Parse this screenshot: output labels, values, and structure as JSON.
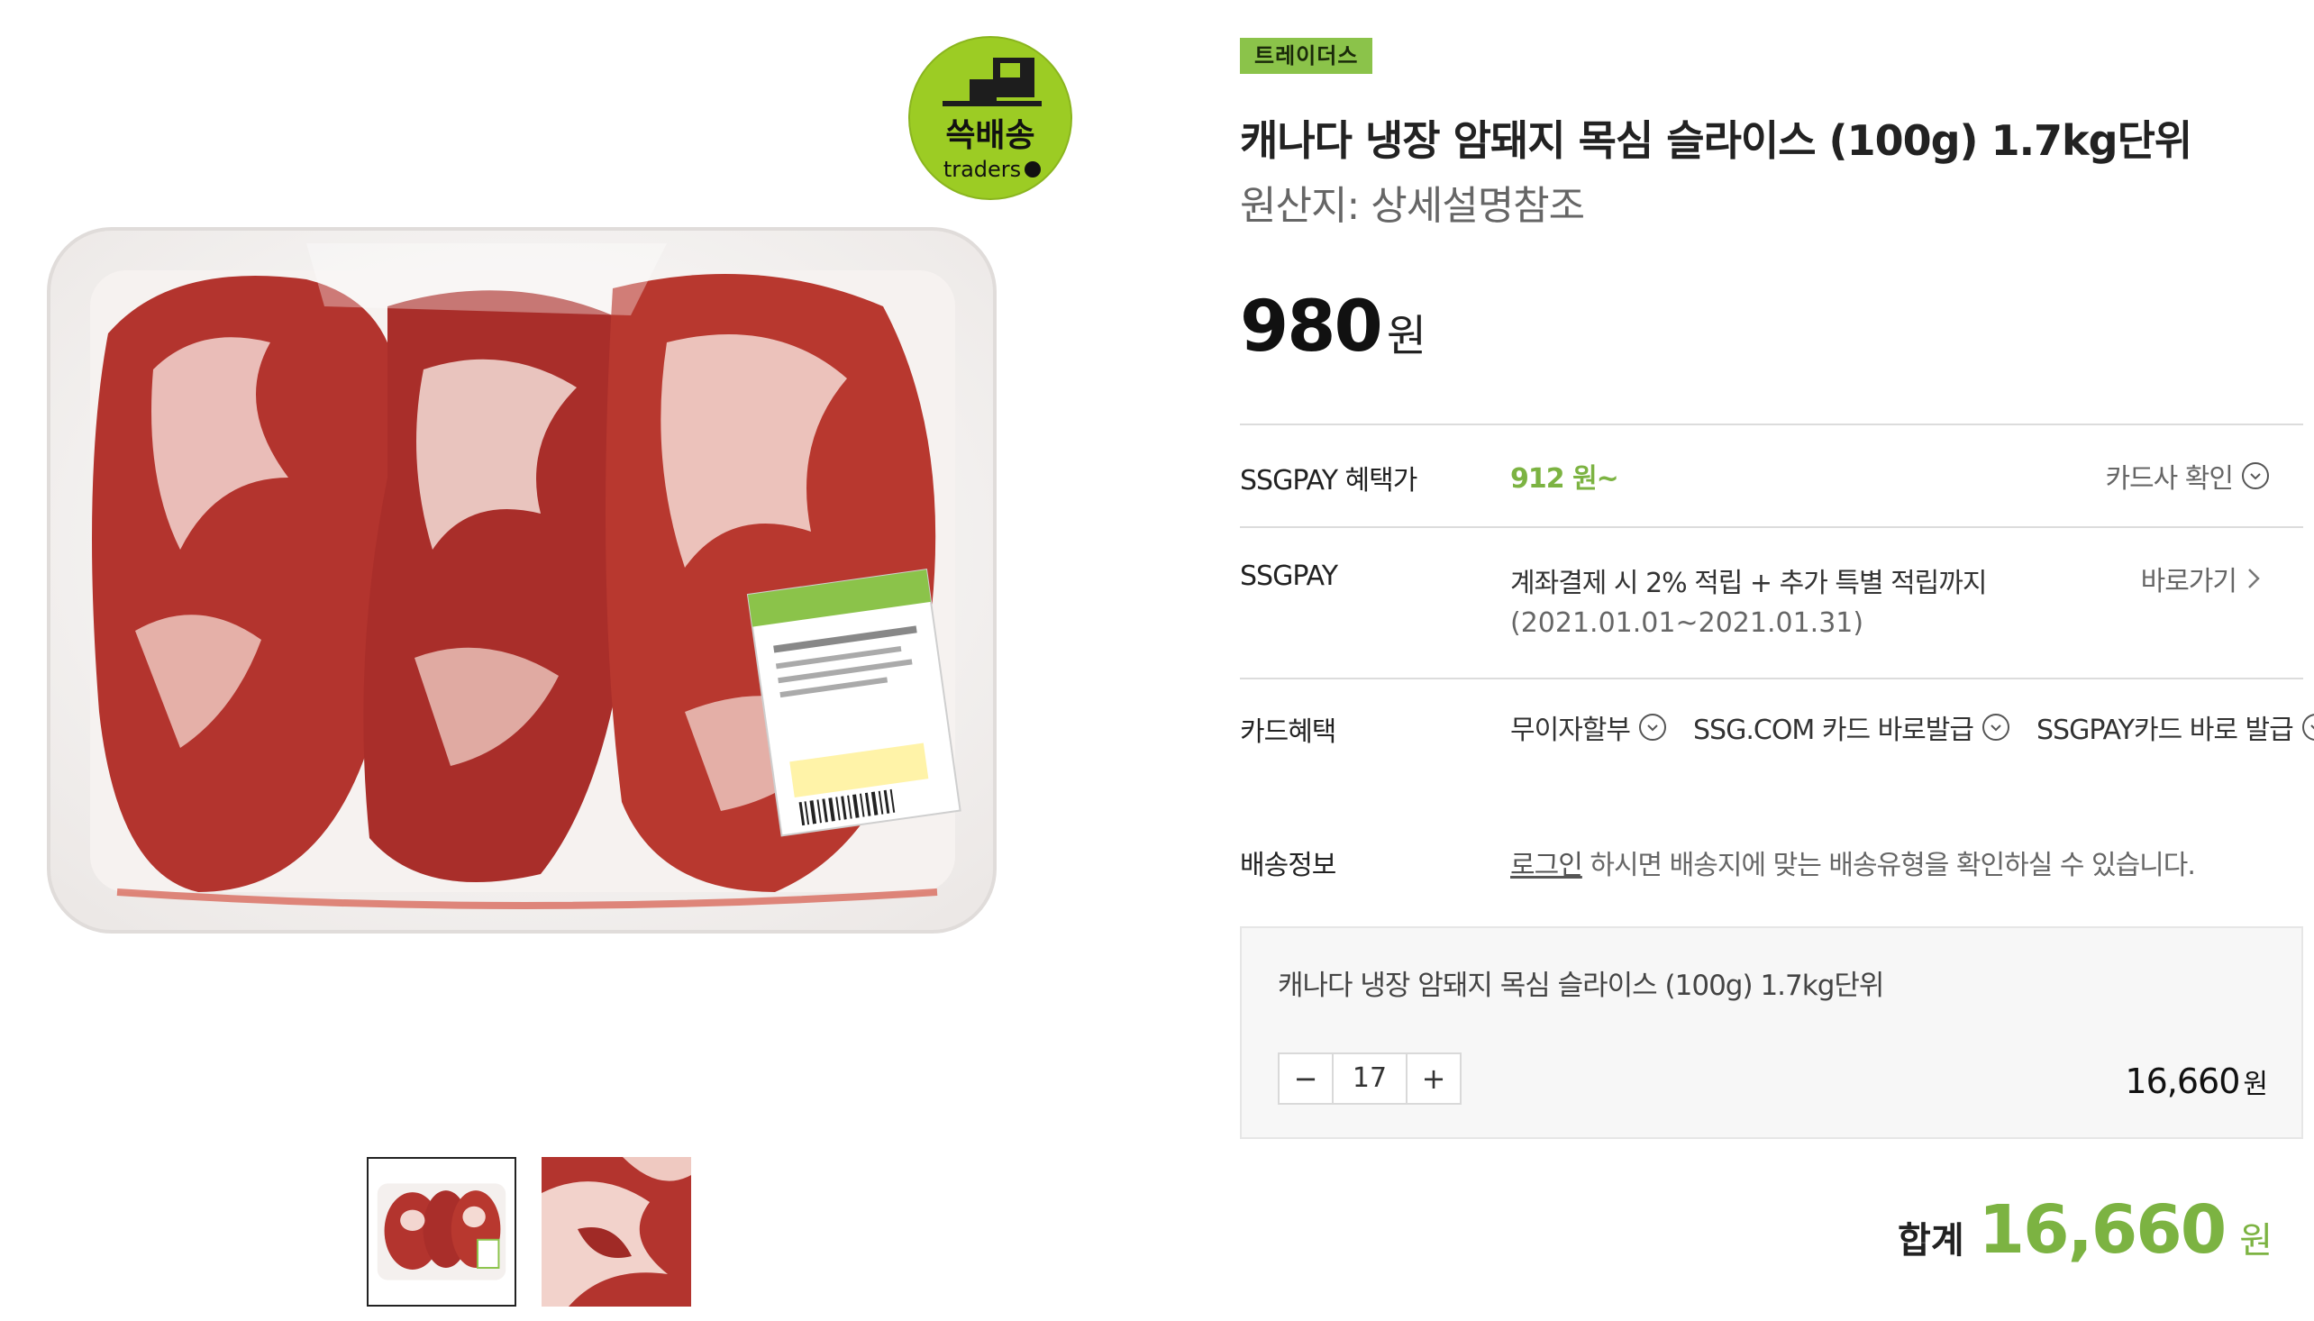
{
  "logo": {
    "text_top": "쓱배송",
    "text_bottom": "traders"
  },
  "product": {
    "brand": "트레이더스",
    "title": "캐나다 냉장 암돼지 목심 슬라이스 (100g) 1.7kg단위",
    "origin": "원산지: 상세설명참조",
    "price": "980",
    "price_unit": "원"
  },
  "benefits": {
    "ssgpay_price": {
      "label": "SSGPAY 혜택가",
      "value": "912 원~",
      "action": "카드사 확인"
    },
    "ssgpay": {
      "label": "SSGPAY",
      "value": "계좌결제 시 2% 적립 + 추가 특별 적립까지",
      "note": "(2021.01.01~2021.01.31)",
      "action": "바로가기"
    },
    "card": {
      "label": "카드혜택",
      "options": [
        "무이자할부",
        "SSG.COM 카드 바로발급",
        "SSGPAY카드 바로 발급"
      ]
    },
    "shipping": {
      "label": "배송정보",
      "link": "로그인",
      "text": " 하시면 배송지에 맞는 배송유형을 확인하실 수 있습니다."
    }
  },
  "option": {
    "name": "캐나다 냉장 암돼지 목심 슬라이스 (100g) 1.7kg단위",
    "quantity": "17",
    "minus": "−",
    "plus": "+",
    "price": "16,660",
    "price_unit": "원"
  },
  "total": {
    "label": "합계",
    "value": "16,660",
    "unit": "원"
  },
  "colors": {
    "accent": "#7cb342",
    "badge": "#8bc34a",
    "meat": "#b3342e"
  }
}
